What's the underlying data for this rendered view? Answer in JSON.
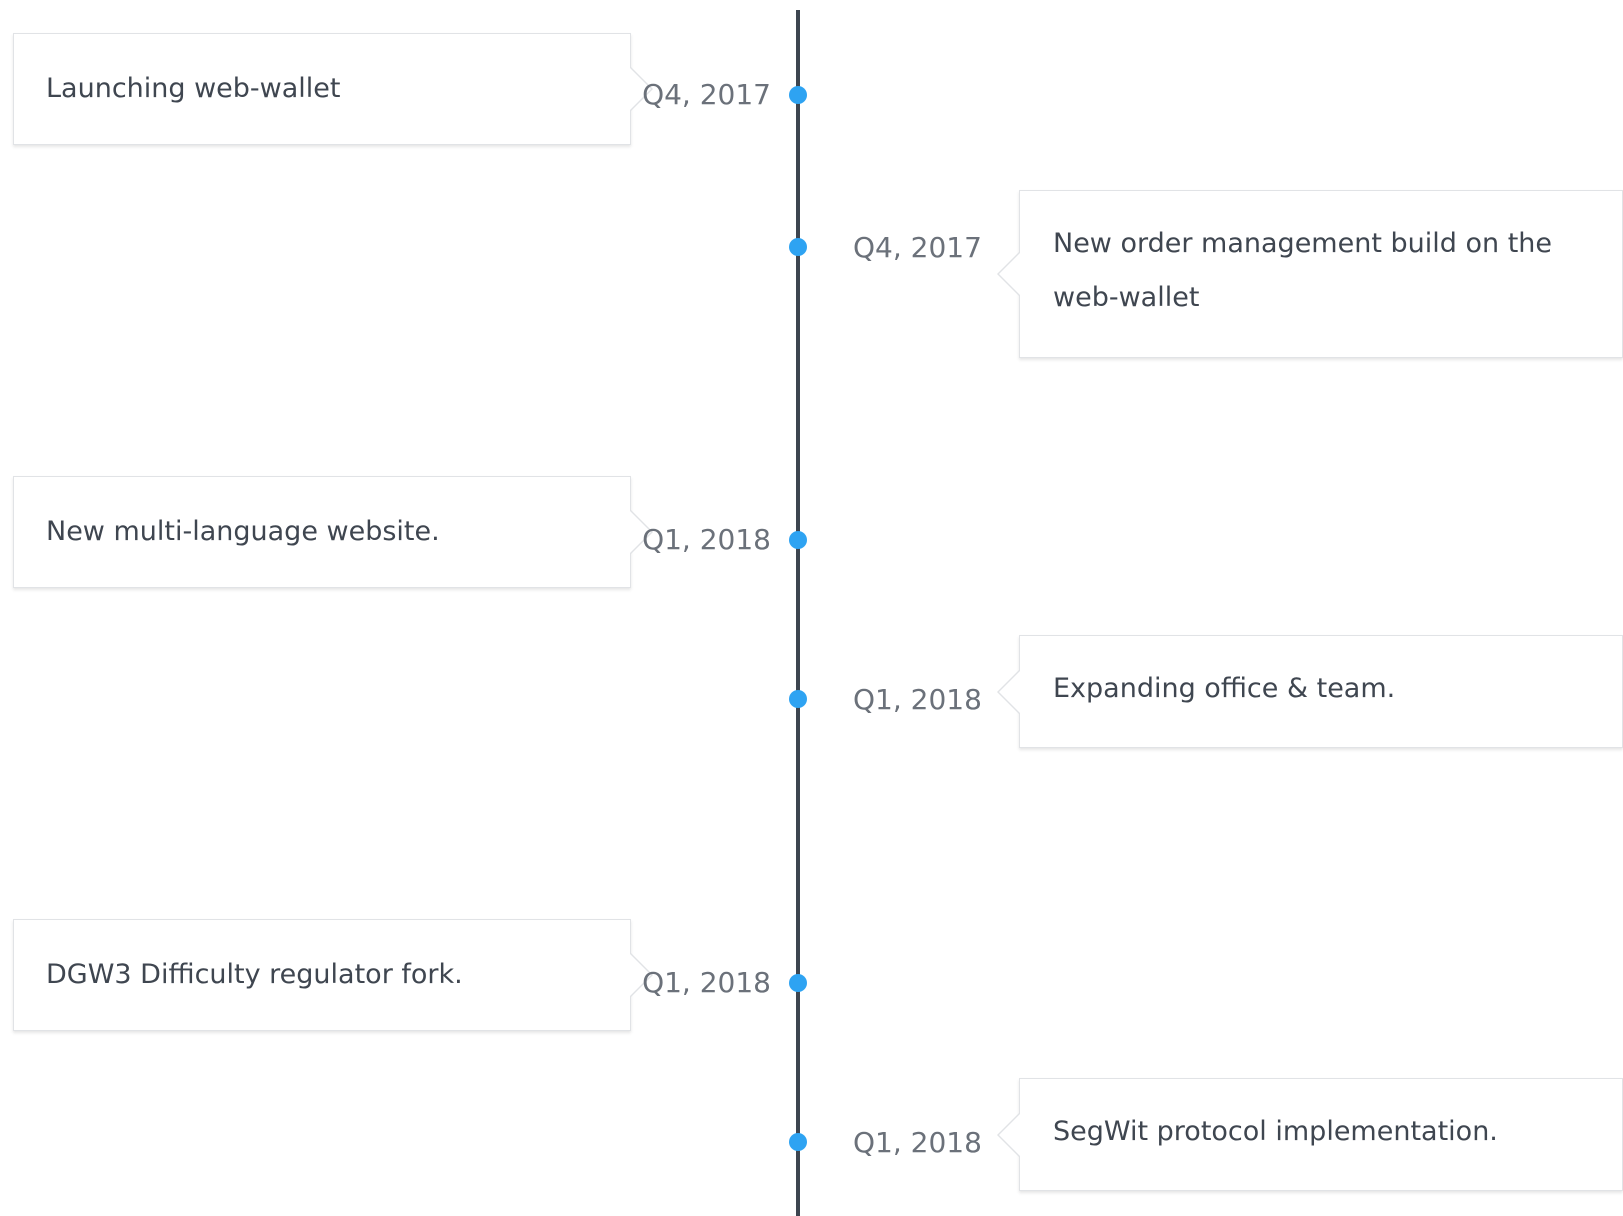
{
  "timeline": {
    "events": [
      {
        "date": "Q4, 2017",
        "text": "Launching web-wallet",
        "side": "left"
      },
      {
        "date": "Q4, 2017",
        "text": "New order management build on the web-wallet",
        "side": "right"
      },
      {
        "date": "Q1, 2018",
        "text": "New multi-language website.",
        "side": "left"
      },
      {
        "date": "Q1, 2018",
        "text": "Expanding office & team.",
        "side": "right"
      },
      {
        "date": "Q1, 2018",
        "text": "DGW3 Difficulty regulator fork.",
        "side": "left"
      },
      {
        "date": "Q1, 2018",
        "text": "SegWit protocol implementation.",
        "side": "right"
      }
    ]
  },
  "colors": {
    "axis": "#3d4550",
    "dot": "#2ea3f2",
    "card_border": "#e1e3e6",
    "card_text": "#3f4650",
    "date_text": "#6b717a"
  }
}
